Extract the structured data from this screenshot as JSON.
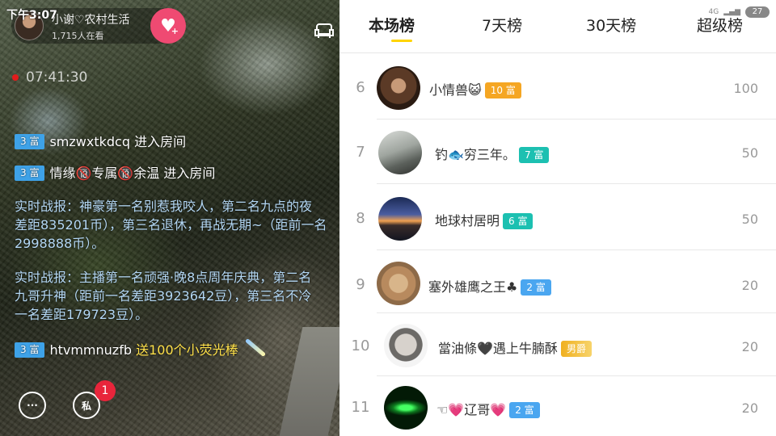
{
  "status_bar": {
    "time": "下午3:07",
    "network": "4G",
    "battery": "27"
  },
  "stream": {
    "host": {
      "name": "小谢♡农村生活",
      "viewers": "1,715人在看"
    },
    "elapsed": "07:41:30",
    "chat": [
      {
        "level": "3 富",
        "user": "smzwxtkdcq",
        "action": "进入房间"
      },
      {
        "level": "3 富",
        "user": "情缘🔞专属🔞余温",
        "action": "进入房间"
      }
    ],
    "system_messages": [
      {
        "lines": [
          "实时战报：神豪第一名别惹我咬人，第二名九点的夜",
          "差距835201币），第三名退休，再战无期~（距前一名",
          "2998888币）。"
        ]
      },
      {
        "lines": [
          "实时战报：主播第一名顽强·晚8点周年庆典，第二名",
          "九哥升神（距前一名差距3923642豆），第三名不冷",
          "一名差距179723豆）。"
        ]
      }
    ],
    "gift": {
      "level": "3 富",
      "user": "htvmmnuzfb",
      "text": "送100个小荧光棒"
    },
    "bottom": {
      "private_label": "私",
      "badge_count": "1"
    }
  },
  "ranking": {
    "tabs": [
      {
        "label": "本场榜",
        "active": true
      },
      {
        "label": "7天榜",
        "active": false
      },
      {
        "label": "30天榜",
        "active": false
      },
      {
        "label": "超级榜",
        "active": false
      }
    ],
    "rows": [
      {
        "rank": "6",
        "name": "小情兽😺",
        "tag": "10 富",
        "tag_color": "#f5a623",
        "score": "100"
      },
      {
        "rank": "7",
        "name": "钓🐟穷三年。",
        "tag": "7 富",
        "tag_color": "#1cc0b1",
        "score": "50"
      },
      {
        "rank": "8",
        "name": "地球村居明",
        "tag": "6 富",
        "tag_color": "#1cc0b1",
        "score": "50"
      },
      {
        "rank": "9",
        "name": "塞外雄鹰之王♣",
        "tag": "2 富",
        "tag_color": "#4aa6f0",
        "score": "20"
      },
      {
        "rank": "10",
        "name": "當油條🖤遇上牛腩酥",
        "tag": "男爵",
        "tag_color": "#f0b020",
        "score": "20"
      },
      {
        "rank": "11",
        "name": "☜💗辽哥💗",
        "tag": "2 富",
        "tag_color": "#4aa6f0",
        "score": "20"
      }
    ]
  }
}
